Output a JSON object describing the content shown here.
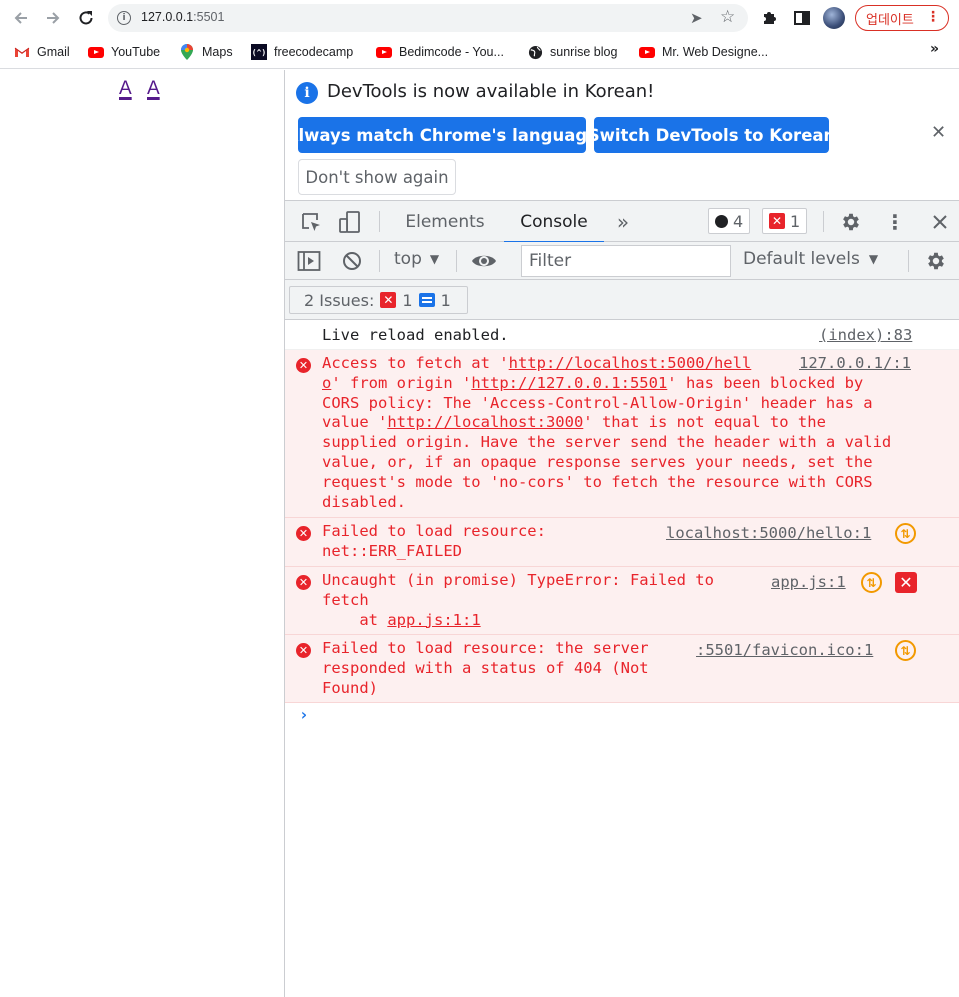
{
  "browser": {
    "url_host": "127.0.0.1",
    "url_port": ":5501",
    "update_label": "업데이트",
    "bookmarks": [
      {
        "label": "Gmail",
        "icon": "gmail-icon"
      },
      {
        "label": "YouTube",
        "icon": "youtube-icon"
      },
      {
        "label": "Maps",
        "icon": "maps-icon"
      },
      {
        "label": "freecodecamp",
        "icon": "freecodecamp-icon"
      },
      {
        "label": "Bedimcode - You...",
        "icon": "youtube-icon"
      },
      {
        "label": "sunrise blog",
        "icon": "globe-icon"
      },
      {
        "label": "Mr. Web Designe...",
        "icon": "youtube-icon"
      }
    ],
    "bookmarks_more": "»"
  },
  "page": {
    "links": [
      "A",
      "A"
    ]
  },
  "devtools": {
    "infobar": {
      "message": "DevTools is now available in Korean!",
      "match_language_label": "Always match Chrome's language",
      "switch_label": "Switch DevTools to Korean",
      "dont_show_label": "Don't show again"
    },
    "tabs": {
      "elements": "Elements",
      "console": "Console",
      "more": "»",
      "warnings_count": "4",
      "errors_count": "1"
    },
    "console_bar": {
      "context": "top",
      "filter_placeholder": "Filter",
      "levels": "Default levels"
    },
    "issues": {
      "label": "2 Issues:",
      "errors": "1",
      "messages": "1"
    },
    "messages": [
      {
        "type": "log",
        "text": "Live reload enabled.",
        "source": "(index):83"
      },
      {
        "type": "error",
        "source": "127.0.0.1/:1"
      },
      {
        "type": "error",
        "text": "Failed to load resource:\nnet::ERR_FAILED",
        "source": "localhost:5000/hello:1"
      },
      {
        "type": "error",
        "text": "Uncaught (in promise) TypeError: Failed to\nfetch\n    at ",
        "trace_link": "app.js:1:1",
        "source": "app.js:1"
      },
      {
        "type": "error",
        "text": "Failed to load resource: the server\nresponded with a status of 404 (Not\nFound)",
        "source": ":5501/favicon.ico:1"
      }
    ],
    "cors_error": {
      "p1": "Access to fetch at '",
      "link1": "http://localhost:5000/hell",
      "p2": "o",
      "p3": "' from origin '",
      "link2": "http://127.0.0.1:5501",
      "p4": "' has been blocked by\nCORS policy: The 'Access-Control-Allow-Origin' header has a\nvalue '",
      "link3": "http://localhost:3000",
      "p5": "' that is not equal to the\nsupplied origin. Have the server send the header with a valid\nvalue, or, if an opaque response serves your needs, set the\nrequest's mode to 'no-cors' to fetch the resource with CORS\ndisabled."
    },
    "prompt": "›"
  }
}
